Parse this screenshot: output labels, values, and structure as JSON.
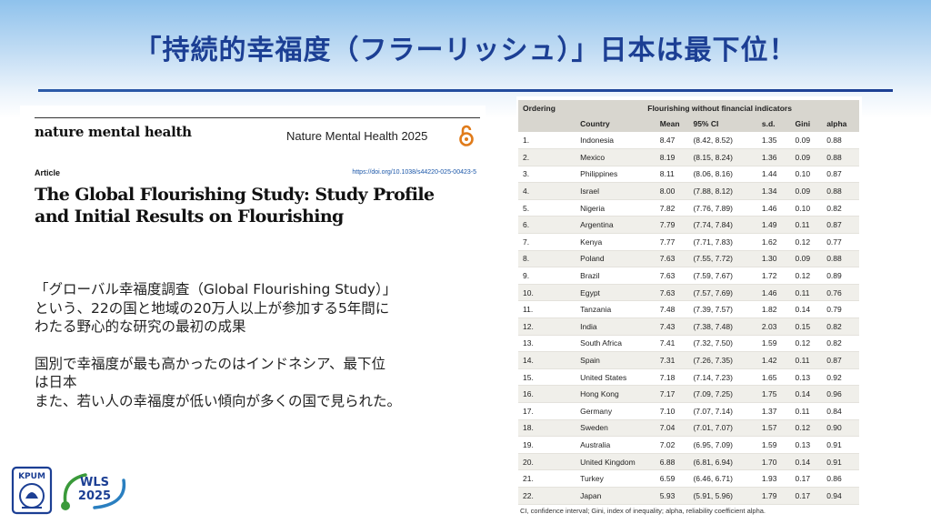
{
  "slide": {
    "title": "「持続的幸福度（フラーリッシュ）」日本は最下位！"
  },
  "paper": {
    "journal_logo": "nature mental health",
    "citation": "Nature Mental Health 2025",
    "article_label": "Article",
    "doi": "https://doi.org/10.1038/s44220-025-00423-5",
    "title_line1": "The Global Flourishing Study: Study Profile",
    "title_line2": "and Initial Results on Flourishing"
  },
  "description": {
    "para1_line1": "「グローバル幸福度調査（Global Flourishing Study）」",
    "para1_line2": "という、22の国と地域の20万人以上が参加する5年間に",
    "para1_line3": "わたる野心的な研究の最初の成果",
    "para2_line1": "国別で幸福度が最も高かったのはインドネシア、最下位",
    "para2_line2": "は日本",
    "para2_line3": "また、若い人の幸福度が低い傾向が多くの国で見られた。"
  },
  "logos": {
    "left_logo_text": "KPUM",
    "right_logo_line1": "WLS",
    "right_logo_line2": "2025",
    "brand_color": "#1c3f94",
    "wls_accent_colors": [
      "#3a9a3a",
      "#2a7fc0"
    ]
  },
  "table": {
    "col_ordering": "Ordering",
    "group_header": "Flourishing without financial indicators",
    "col_country": "Country",
    "col_mean": "Mean",
    "col_ci": "95% CI",
    "col_sd": "s.d.",
    "col_gini": "Gini",
    "col_alpha": "alpha",
    "rows": [
      {
        "ord": "1.",
        "country": "Indonesia",
        "mean": "8.47",
        "ci": "(8.42, 8.52)",
        "sd": "1.35",
        "gini": "0.09",
        "alpha": "0.88"
      },
      {
        "ord": "2.",
        "country": "Mexico",
        "mean": "8.19",
        "ci": "(8.15, 8.24)",
        "sd": "1.36",
        "gini": "0.09",
        "alpha": "0.88"
      },
      {
        "ord": "3.",
        "country": "Philippines",
        "mean": "8.11",
        "ci": "(8.06, 8.16)",
        "sd": "1.44",
        "gini": "0.10",
        "alpha": "0.87"
      },
      {
        "ord": "4.",
        "country": "Israel",
        "mean": "8.00",
        "ci": "(7.88, 8.12)",
        "sd": "1.34",
        "gini": "0.09",
        "alpha": "0.88"
      },
      {
        "ord": "5.",
        "country": "Nigeria",
        "mean": "7.82",
        "ci": "(7.76, 7.89)",
        "sd": "1.46",
        "gini": "0.10",
        "alpha": "0.82"
      },
      {
        "ord": "6.",
        "country": "Argentina",
        "mean": "7.79",
        "ci": "(7.74, 7.84)",
        "sd": "1.49",
        "gini": "0.11",
        "alpha": "0.87"
      },
      {
        "ord": "7.",
        "country": "Kenya",
        "mean": "7.77",
        "ci": "(7.71, 7.83)",
        "sd": "1.62",
        "gini": "0.12",
        "alpha": "0.77"
      },
      {
        "ord": "8.",
        "country": "Poland",
        "mean": "7.63",
        "ci": "(7.55, 7.72)",
        "sd": "1.30",
        "gini": "0.09",
        "alpha": "0.88"
      },
      {
        "ord": "9.",
        "country": "Brazil",
        "mean": "7.63",
        "ci": "(7.59, 7.67)",
        "sd": "1.72",
        "gini": "0.12",
        "alpha": "0.89"
      },
      {
        "ord": "10.",
        "country": "Egypt",
        "mean": "7.63",
        "ci": "(7.57, 7.69)",
        "sd": "1.46",
        "gini": "0.11",
        "alpha": "0.76"
      },
      {
        "ord": "11.",
        "country": "Tanzania",
        "mean": "7.48",
        "ci": "(7.39, 7.57)",
        "sd": "1.82",
        "gini": "0.14",
        "alpha": "0.79"
      },
      {
        "ord": "12.",
        "country": "India",
        "mean": "7.43",
        "ci": "(7.38, 7.48)",
        "sd": "2.03",
        "gini": "0.15",
        "alpha": "0.82"
      },
      {
        "ord": "13.",
        "country": "South Africa",
        "mean": "7.41",
        "ci": "(7.32, 7.50)",
        "sd": "1.59",
        "gini": "0.12",
        "alpha": "0.82"
      },
      {
        "ord": "14.",
        "country": "Spain",
        "mean": "7.31",
        "ci": "(7.26, 7.35)",
        "sd": "1.42",
        "gini": "0.11",
        "alpha": "0.87"
      },
      {
        "ord": "15.",
        "country": "United States",
        "mean": "7.18",
        "ci": "(7.14, 7.23)",
        "sd": "1.65",
        "gini": "0.13",
        "alpha": "0.92"
      },
      {
        "ord": "16.",
        "country": "Hong Kong",
        "mean": "7.17",
        "ci": "(7.09, 7.25)",
        "sd": "1.75",
        "gini": "0.14",
        "alpha": "0.96"
      },
      {
        "ord": "17.",
        "country": "Germany",
        "mean": "7.10",
        "ci": "(7.07, 7.14)",
        "sd": "1.37",
        "gini": "0.11",
        "alpha": "0.84"
      },
      {
        "ord": "18.",
        "country": "Sweden",
        "mean": "7.04",
        "ci": "(7.01, 7.07)",
        "sd": "1.57",
        "gini": "0.12",
        "alpha": "0.90"
      },
      {
        "ord": "19.",
        "country": "Australia",
        "mean": "7.02",
        "ci": "(6.95, 7.09)",
        "sd": "1.59",
        "gini": "0.13",
        "alpha": "0.91"
      },
      {
        "ord": "20.",
        "country": "United Kingdom",
        "mean": "6.88",
        "ci": "(6.81, 6.94)",
        "sd": "1.70",
        "gini": "0.14",
        "alpha": "0.91"
      },
      {
        "ord": "21.",
        "country": "Turkey",
        "mean": "6.59",
        "ci": "(6.46, 6.71)",
        "sd": "1.93",
        "gini": "0.17",
        "alpha": "0.86"
      },
      {
        "ord": "22.",
        "country": "Japan",
        "mean": "5.93",
        "ci": "(5.91, 5.96)",
        "sd": "1.79",
        "gini": "0.17",
        "alpha": "0.94"
      }
    ],
    "note": "CI, confidence interval; Gini, index of inequality; alpha, reliability coefficient alpha."
  },
  "colors": {
    "title": "#1c3f94",
    "header_band": "#8fc2ec",
    "table_header": "#d8d6cf",
    "table_stripe": "#f0efea",
    "oa_icon": "#e07b1a"
  }
}
